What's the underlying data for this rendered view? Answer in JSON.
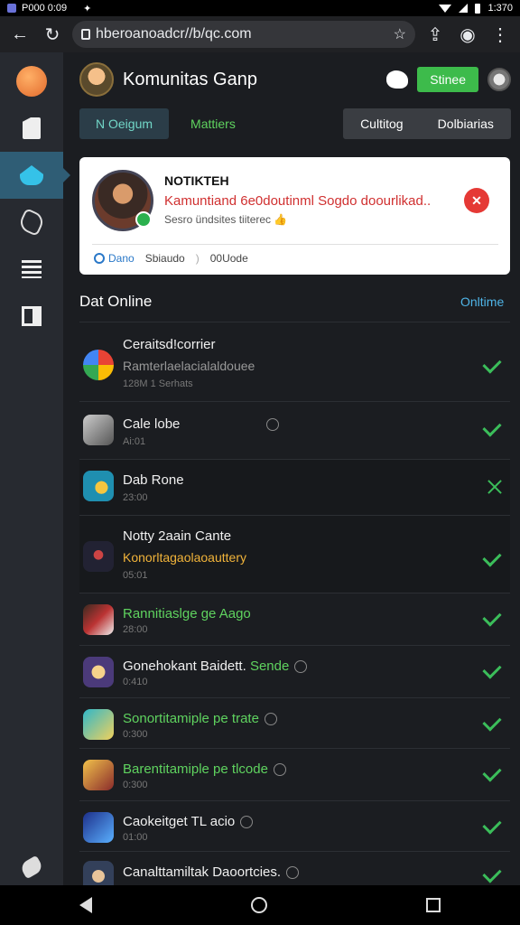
{
  "status_bar": {
    "left": "P000 0:09",
    "time": "1:370"
  },
  "browser": {
    "url": "hberoanoadcr//b/qc.com",
    "back_icon": "arrow-left-icon",
    "reload_icon": "reload-icon",
    "star_icon": "star-icon",
    "share_icon": "share-icon",
    "menu_icon": "more-vert-icon"
  },
  "header": {
    "title": "Komunitas Ganp",
    "join_label": "Stinee"
  },
  "tabs_left": [
    {
      "label": "N Oeigum"
    },
    {
      "label": "Mattiers"
    }
  ],
  "tabs_right": [
    {
      "label": "Cultitog"
    },
    {
      "label": "Dolbiarias"
    }
  ],
  "notification": {
    "head": "NOTIKTEH",
    "message": "Kamuntiand 6e0doutinml Sogdo doourlikad..",
    "sub": "Sesro ündsites tiiterec 👍",
    "close_label": "✕",
    "actions": [
      "Dano",
      "Sbiaudo",
      "00Uode"
    ]
  },
  "section": {
    "title": "Dat Online",
    "link": "Onltime"
  },
  "rows": [
    {
      "title": "Ceraitsd!corrier",
      "sub": "Ramterlaelacialaldouee",
      "sub_color": "grey",
      "meta": "128M 1 Serhats",
      "status": "check"
    },
    {
      "title": "Cale lobe",
      "meta": "Ai:01",
      "status": "check",
      "at": true
    },
    {
      "title": "Dab Rone",
      "meta": "23:00",
      "status": "x"
    },
    {
      "title": "Notty 2aain Cante",
      "sub": "Konorltagaolaoauttery",
      "sub_color": "yellow",
      "meta": "05:01",
      "status": "check"
    },
    {
      "title": "Rannitiaslge ge Aago",
      "title_color": "green",
      "meta": "28:00",
      "status": "check"
    },
    {
      "title": "Gonehokant Baidett.",
      "title_suffix": "Sende",
      "meta": "0:410",
      "status": "check",
      "at": true
    },
    {
      "title": "Sonortitamiple pe trate",
      "title_color": "green",
      "meta": "0:300",
      "status": "check",
      "at": true
    },
    {
      "title": "Barentitamiple pe tlcode",
      "title_color": "green",
      "meta": "0:300",
      "status": "check",
      "at": true
    },
    {
      "title": "Caokeitget TL acio",
      "meta": "01:00",
      "status": "check",
      "at": true
    },
    {
      "title": "Canalttamiltak Daoortcies.",
      "meta": "",
      "status": "check",
      "at": true
    }
  ],
  "sidebar_icons": [
    "avatar-icon",
    "document-icon",
    "game-icon",
    "puzzle-icon",
    "list-icon",
    "flag-icon",
    "wrench-icon"
  ]
}
